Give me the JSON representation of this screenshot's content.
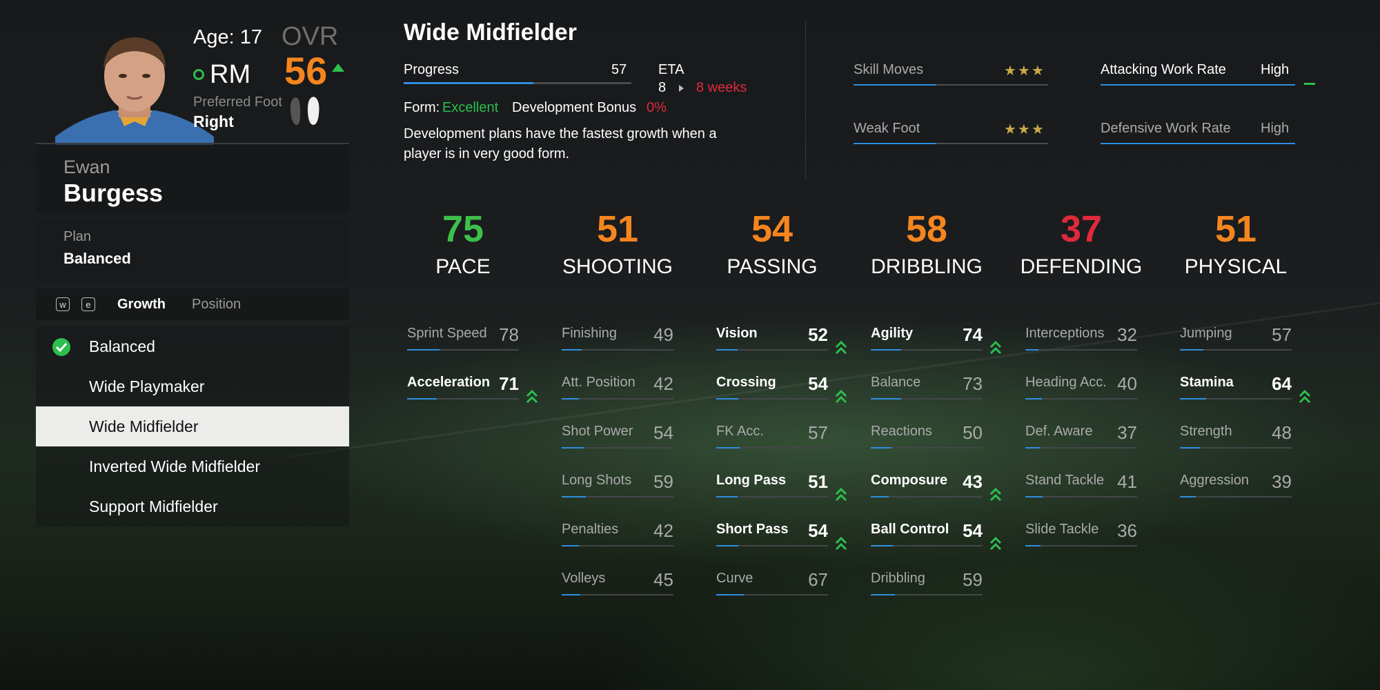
{
  "player": {
    "age_label": "Age: 17",
    "position": "RM",
    "ovr_label": "OVR",
    "ovr": "56",
    "preferred_foot_label": "Preferred Foot",
    "preferred_foot": "Right",
    "first_name": "Ewan",
    "last_name": "Burgess",
    "plan_label": "Plan",
    "plan_value": "Balanced",
    "colors": {
      "accent": "#f5851f",
      "good": "#2dbf4e",
      "bad": "#e02a3c",
      "bar": "#2f8fe0"
    }
  },
  "tabs": {
    "key_w": "w",
    "key_e": "e",
    "growth": "Growth",
    "position": "Position"
  },
  "plans": [
    {
      "label": "Balanced",
      "checked": true,
      "selected": false
    },
    {
      "label": "Wide Playmaker",
      "checked": false,
      "selected": false
    },
    {
      "label": "Wide Midfielder",
      "checked": false,
      "selected": true
    },
    {
      "label": "Inverted Wide Midfielder",
      "checked": false,
      "selected": false
    },
    {
      "label": "Support Midfielder",
      "checked": false,
      "selected": false
    }
  ],
  "detail": {
    "title": "Wide Midfielder",
    "progress_label": "Progress",
    "progress_value": "57",
    "progress_fraction": 0.57,
    "eta_label": "ETA",
    "eta_number": "8",
    "eta_weeks": "8 weeks",
    "form_label": "Form:",
    "form_value": "Excellent",
    "bonus_label": "Development Bonus",
    "bonus_value": "0%",
    "description": "Development plans have the fastest growth when a player is in very good form."
  },
  "traits": {
    "skill_moves_label": "Skill Moves",
    "skill_moves_stars": "★★★",
    "weak_foot_label": "Weak Foot",
    "weak_foot_stars": "★★★",
    "att_wr_label": "Attacking Work Rate",
    "att_wr_value": "High",
    "def_wr_label": "Defensive Work Rate",
    "def_wr_value": "High"
  },
  "categories": [
    {
      "value": "75",
      "name": "PACE",
      "color": "#3dbf4a"
    },
    {
      "value": "51",
      "name": "SHOOTING",
      "color": "#f5851f"
    },
    {
      "value": "54",
      "name": "PASSING",
      "color": "#f5851f"
    },
    {
      "value": "58",
      "name": "DRIBBLING",
      "color": "#f5851f"
    },
    {
      "value": "37",
      "name": "DEFENDING",
      "color": "#e02a3c"
    },
    {
      "value": "51",
      "name": "PHYSICAL",
      "color": "#f5851f"
    }
  ],
  "stats": [
    [
      {
        "label": "Sprint Speed",
        "value": 78,
        "highlight": false
      },
      {
        "label": "Acceleration",
        "value": 71,
        "highlight": true
      }
    ],
    [
      {
        "label": "Finishing",
        "value": 49,
        "highlight": false
      },
      {
        "label": "Att. Position",
        "value": 42,
        "highlight": false
      },
      {
        "label": "Shot Power",
        "value": 54,
        "highlight": false
      },
      {
        "label": "Long Shots",
        "value": 59,
        "highlight": false
      },
      {
        "label": "Penalties",
        "value": 42,
        "highlight": false
      },
      {
        "label": "Volleys",
        "value": 45,
        "highlight": false
      }
    ],
    [
      {
        "label": "Vision",
        "value": 52,
        "highlight": true
      },
      {
        "label": "Crossing",
        "value": 54,
        "highlight": true
      },
      {
        "label": "FK Acc.",
        "value": 57,
        "highlight": false
      },
      {
        "label": "Long Pass",
        "value": 51,
        "highlight": true
      },
      {
        "label": "Short Pass",
        "value": 54,
        "highlight": true
      },
      {
        "label": "Curve",
        "value": 67,
        "highlight": false
      }
    ],
    [
      {
        "label": "Agility",
        "value": 74,
        "highlight": true
      },
      {
        "label": "Balance",
        "value": 73,
        "highlight": false
      },
      {
        "label": "Reactions",
        "value": 50,
        "highlight": false
      },
      {
        "label": "Composure",
        "value": 43,
        "highlight": true
      },
      {
        "label": "Ball Control",
        "value": 54,
        "highlight": true
      },
      {
        "label": "Dribbling",
        "value": 59,
        "highlight": false
      }
    ],
    [
      {
        "label": "Interceptions",
        "value": 32,
        "highlight": false
      },
      {
        "label": "Heading Acc.",
        "value": 40,
        "highlight": false
      },
      {
        "label": "Def. Aware",
        "value": 37,
        "highlight": false
      },
      {
        "label": "Stand Tackle",
        "value": 41,
        "highlight": false
      },
      {
        "label": "Slide Tackle",
        "value": 36,
        "highlight": false
      }
    ],
    [
      {
        "label": "Jumping",
        "value": 57,
        "highlight": false
      },
      {
        "label": "Stamina",
        "value": 64,
        "highlight": true
      },
      {
        "label": "Strength",
        "value": 48,
        "highlight": false
      },
      {
        "label": "Aggression",
        "value": 39,
        "highlight": false
      }
    ]
  ]
}
